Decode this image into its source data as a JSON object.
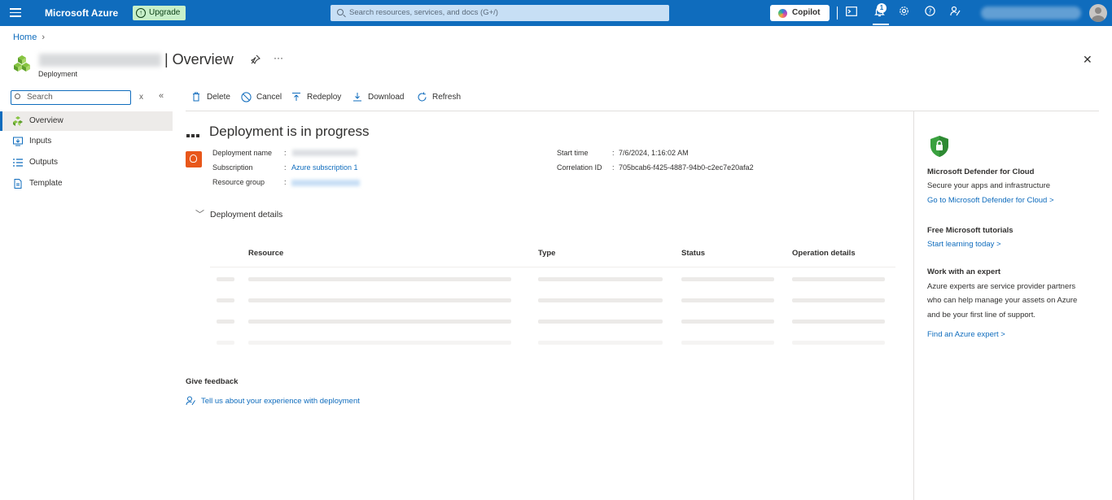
{
  "topbar": {
    "brand": "Microsoft Azure",
    "upgrade_label": "Upgrade",
    "search_placeholder": "Search resources, services, and docs (G+/)",
    "copilot_label": "Copilot",
    "notification_count": "1",
    "icons": [
      "menu-icon",
      "cloud-shell-icon",
      "notifications-icon",
      "settings-icon",
      "help-icon",
      "feedback-icon"
    ]
  },
  "breadcrumb": {
    "home": "Home"
  },
  "header": {
    "title": "| Overview",
    "subtitle": "Deployment",
    "pin": "📌",
    "more": "···",
    "close": "✕"
  },
  "sidebar": {
    "search_placeholder": "Search",
    "items": [
      {
        "label": "Overview",
        "icon": "deployment-icon",
        "active": true
      },
      {
        "label": "Inputs",
        "icon": "inputs-icon",
        "active": false
      },
      {
        "label": "Outputs",
        "icon": "outputs-icon",
        "active": false
      },
      {
        "label": "Template",
        "icon": "template-icon",
        "active": false
      }
    ]
  },
  "toolbar": {
    "delete": "Delete",
    "cancel": "Cancel",
    "redeploy": "Redeploy",
    "download": "Download",
    "refresh": "Refresh"
  },
  "status": {
    "title": "Deployment is in progress",
    "fields": {
      "deployment_name_label": "Deployment name",
      "subscription_label": "Subscription",
      "subscription_value": "Azure subscription 1",
      "resource_group_label": "Resource group",
      "start_time_label": "Start time",
      "start_time_value": "7/6/2024, 1:16:02 AM",
      "correlation_id_label": "Correlation ID",
      "correlation_id_value": "705bcab6-f425-4887-94b0-c2ec7e20afa2"
    }
  },
  "details": {
    "heading": "Deployment details",
    "columns": [
      "Resource",
      "Type",
      "Status",
      "Operation details"
    ]
  },
  "feedback": {
    "title": "Give feedback",
    "link": "Tell us about your experience with deployment"
  },
  "right_panel": {
    "defender_title": "Microsoft Defender for Cloud",
    "defender_text": "Secure your apps and infrastructure",
    "defender_link": "Go to Microsoft Defender for Cloud >",
    "tutorials_title": "Free Microsoft tutorials",
    "tutorials_link": "Start learning today >",
    "expert_title": "Work with an expert",
    "expert_text_1": "Azure experts are service provider partners",
    "expert_text_2": "who can help manage your assets on Azure",
    "expert_text_3": "and be your first line of support.",
    "expert_link": "Find an Azure expert >"
  },
  "colors": {
    "accent": "#0f6cbd",
    "upgrade_bg": "#c7f0c9",
    "status_icon": "#e8571a"
  }
}
